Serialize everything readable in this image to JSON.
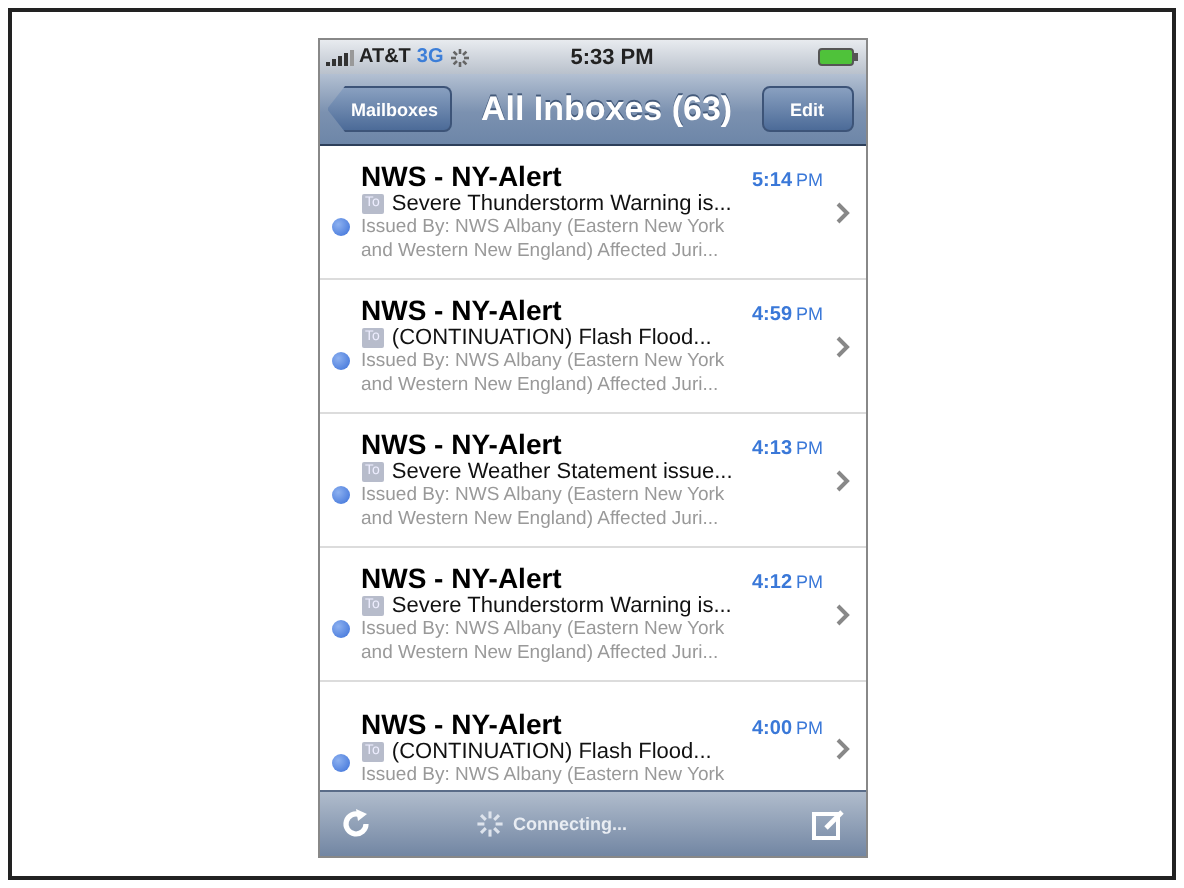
{
  "status_bar": {
    "carrier": "AT&T",
    "network": "3G",
    "time": "5:33 PM"
  },
  "nav_bar": {
    "back_button": "Mailboxes",
    "title": "All Inboxes (63)",
    "edit_button": "Edit"
  },
  "messages": [
    {
      "sender": "NWS - NY-Alert",
      "time": "5:14",
      "period": "PM",
      "badge": "To",
      "subject": "Severe Thunderstorm Warning is...",
      "preview_lines": [
        "Issued By: NWS Albany (Eastern New York",
        "and Western New England) Affected Juri..."
      ],
      "unread": true
    },
    {
      "sender": "NWS - NY-Alert",
      "time": "4:59",
      "period": "PM",
      "badge": "To",
      "subject": "(CONTINUATION)  Flash Flood...",
      "preview_lines": [
        "Issued By: NWS Albany (Eastern New York",
        "and Western New England) Affected Juri..."
      ],
      "unread": true
    },
    {
      "sender": "NWS - NY-Alert",
      "time": "4:13",
      "period": "PM",
      "badge": "To",
      "subject": "Severe Weather Statement issue...",
      "preview_lines": [
        "Issued By: NWS Albany (Eastern New York",
        "and Western New England) Affected Juri..."
      ],
      "unread": true
    },
    {
      "sender": "NWS - NY-Alert",
      "time": "4:12",
      "period": "PM",
      "badge": "To",
      "subject": "Severe Thunderstorm Warning is...",
      "preview_lines": [
        "Issued By: NWS Albany (Eastern New York",
        "and Western New England) Affected Juri..."
      ],
      "unread": true
    },
    {
      "sender": "NWS - NY-Alert",
      "time": "4:00",
      "period": "PM",
      "badge": "To",
      "subject": "(CONTINUATION)  Flash Flood...",
      "preview_lines": [
        "Issued By: NWS Albany (Eastern New York"
      ],
      "unread": true
    }
  ],
  "toolbar": {
    "status": "Connecting..."
  }
}
